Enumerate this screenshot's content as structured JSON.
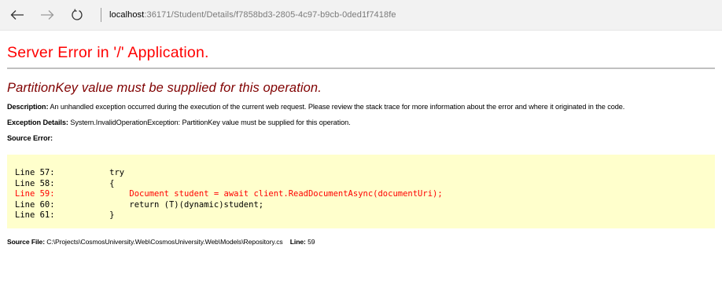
{
  "browser": {
    "url_host": "localhost",
    "url_rest": ":36171/Student/Details/f7858bd3-2805-4c97-b9cb-0ded1f7418fe"
  },
  "page": {
    "title": "Server Error in '/' Application.",
    "error_message": "PartitionKey value must be supplied for this operation.",
    "description_label": "Description:",
    "description_text": " An unhandled exception occurred during the execution of the current web request. Please review the stack trace for more information about the error and where it originated in the code.",
    "exception_label": "Exception Details:",
    "exception_text": " System.InvalidOperationException: PartitionKey value must be supplied for this operation.",
    "source_error_label": "Source Error:",
    "source_lines": [
      {
        "line": "Line 57:",
        "code": "try"
      },
      {
        "line": "Line 58:",
        "code": "{"
      },
      {
        "line": "Line 59:",
        "code": "    Document student = await client.ReadDocumentAsync(documentUri);"
      },
      {
        "line": "Line 60:",
        "code": "    return (T)(dynamic)student;"
      },
      {
        "line": "Line 61:",
        "code": "}"
      }
    ],
    "source_file_label": "Source File:",
    "source_file_path": " C:\\Projects\\CosmosUniversity.Web\\CosmosUniversity.Web\\Models\\Repository.cs",
    "line_label": "Line:",
    "line_value": " 59"
  },
  "colors": {
    "title": "#ff0000",
    "error_message": "#800000",
    "code_background": "#ffffcc",
    "highlight_line": "#ff0000"
  }
}
